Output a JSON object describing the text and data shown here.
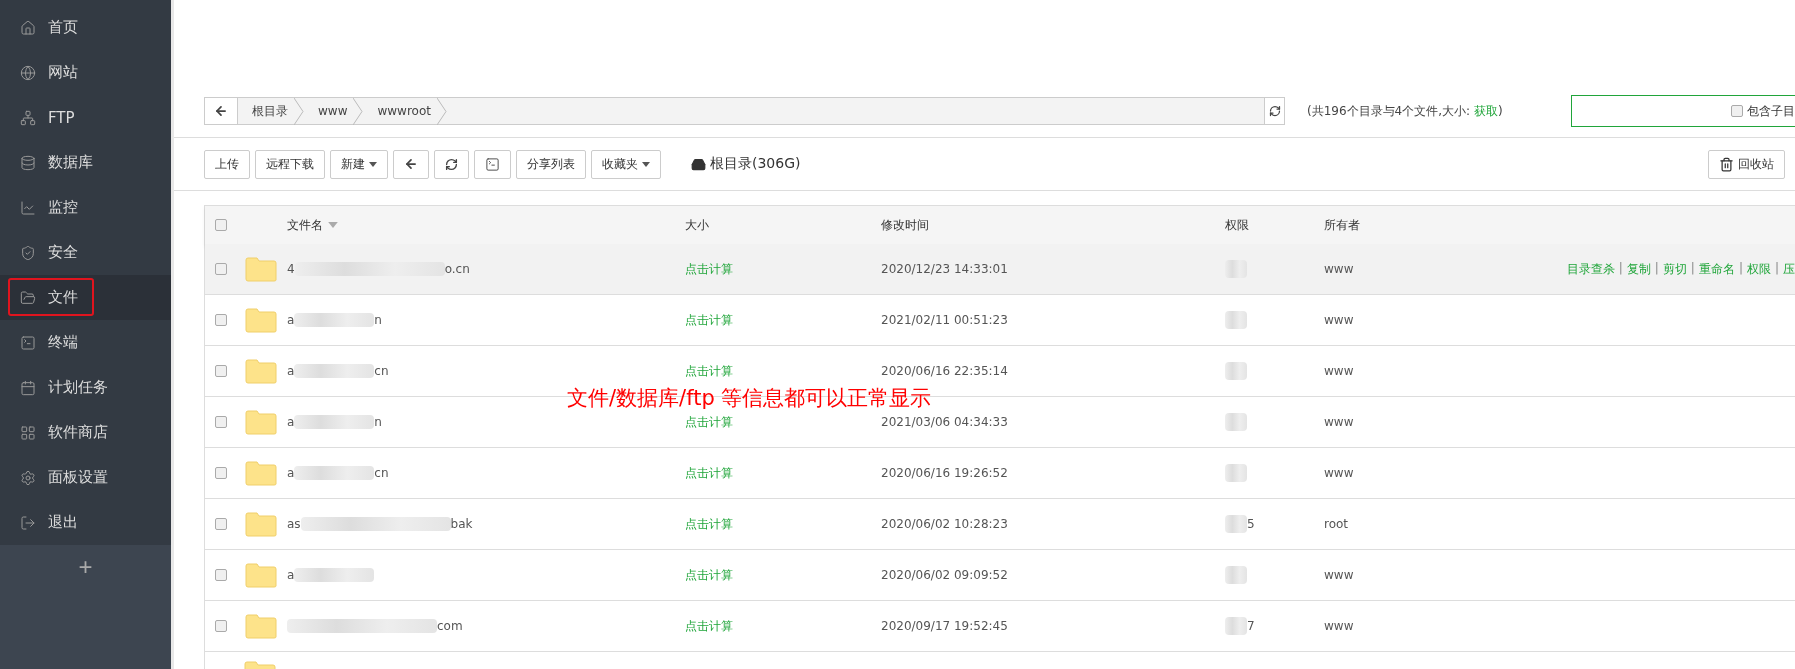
{
  "sidebar": {
    "items": [
      {
        "label": "首页",
        "selected": false
      },
      {
        "label": "网站",
        "selected": false
      },
      {
        "label": "FTP",
        "selected": false
      },
      {
        "label": "数据库",
        "selected": false
      },
      {
        "label": "监控",
        "selected": false
      },
      {
        "label": "安全",
        "selected": false
      },
      {
        "label": "文件",
        "selected": true
      },
      {
        "label": "终端",
        "selected": false
      },
      {
        "label": "计划任务",
        "selected": false
      },
      {
        "label": "软件商店",
        "selected": false
      },
      {
        "label": "面板设置",
        "selected": false
      },
      {
        "label": "退出",
        "selected": false
      }
    ],
    "add": "+"
  },
  "breadcrumb": [
    "根目录",
    "www",
    "wwwroot"
  ],
  "summary": {
    "text": "(共196个目录与4个文件,大小:",
    "link": "获取",
    "close": ")"
  },
  "search": {
    "option": "包含子目",
    "checked": false
  },
  "toolbar": [
    {
      "kind": "text",
      "label": "上传"
    },
    {
      "kind": "text",
      "label": "远程下载"
    },
    {
      "kind": "dropdown",
      "label": "新建"
    },
    {
      "kind": "back"
    },
    {
      "kind": "refresh"
    },
    {
      "kind": "terminal"
    },
    {
      "kind": "text",
      "label": "分享列表"
    },
    {
      "kind": "dropdown",
      "label": "收藏夹"
    }
  ],
  "disk": "根目录(306G)",
  "recycle": "回收站",
  "table": {
    "header_checked": false,
    "columns": [
      "文件名",
      "大小",
      "修改时间",
      "权限",
      "所有者"
    ],
    "rows": [
      {
        "kind": "full",
        "checked": false,
        "highlighted": true,
        "name_start": "4",
        "name_end": "o.cn",
        "size": "点击计算",
        "modified": "2020/12/23 14:33:01",
        "owner": "www",
        "actions": [
          {
            "kind": "link",
            "text": "目录查杀"
          },
          {
            "kind": "sep",
            "text": "|"
          },
          {
            "kind": "link",
            "text": "复制"
          },
          {
            "kind": "sep",
            "text": "|"
          },
          {
            "kind": "link",
            "text": "剪切"
          },
          {
            "kind": "sep",
            "text": "|"
          },
          {
            "kind": "link",
            "text": "重命名"
          },
          {
            "kind": "sep",
            "text": "|"
          },
          {
            "kind": "link",
            "text": "权限"
          },
          {
            "kind": "sep",
            "text": "|"
          },
          {
            "kind": "link",
            "text": "压"
          }
        ]
      },
      {
        "kind": "full",
        "checked": false,
        "highlighted": false,
        "name_start": "a",
        "name_end": "n",
        "size": "点击计算",
        "modified": "2021/02/11 00:51:23",
        "owner": "www"
      },
      {
        "kind": "full",
        "checked": false,
        "highlighted": false,
        "name_start": "a",
        "name_end": "cn",
        "size": "点击计算",
        "modified": "2020/06/16 22:35:14",
        "owner": "www"
      },
      {
        "kind": "full",
        "checked": false,
        "highlighted": false,
        "name_start": "a",
        "name_end": "n",
        "size": "点击计算",
        "modified": "2021/03/06 04:34:33",
        "owner": "www"
      },
      {
        "kind": "full",
        "checked": false,
        "highlighted": false,
        "name_start": "a",
        "name_end": "cn",
        "size": "点击计算",
        "modified": "2020/06/16 19:26:52",
        "owner": "www"
      },
      {
        "kind": "full",
        "checked": false,
        "highlighted": false,
        "name_start": "as",
        "name_end": "bak",
        "size": "点击计算",
        "modified": "2020/06/02 10:28:23",
        "permission": "5",
        "owner": "root"
      },
      {
        "kind": "full",
        "checked": false,
        "highlighted": false,
        "name_start": "a",
        "size": "点击计算",
        "modified": "2020/06/02 09:09:52",
        "owner": "www"
      },
      {
        "kind": "full",
        "checked": false,
        "highlighted": false,
        "name_end": "com",
        "size": "点击计算",
        "modified": "2020/09/17 19:52:45",
        "permission": "7",
        "owner": "www"
      },
      {
        "kind": "cut"
      }
    ]
  },
  "annotation": "文件/数据库/ftp 等信息都可以正常显示"
}
